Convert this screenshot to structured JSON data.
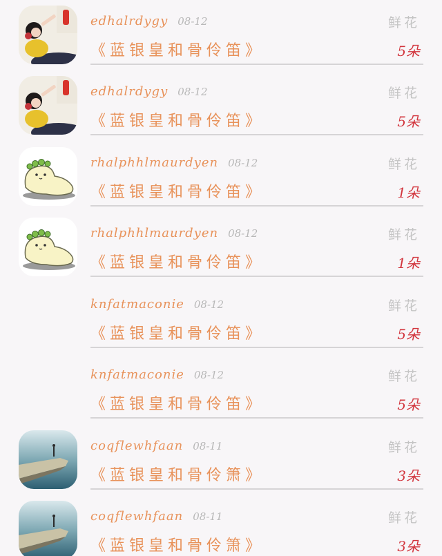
{
  "rows": [
    {
      "user": "edhalrdygy",
      "date": "08-12",
      "book": "《蓝银皇和骨伶笛》",
      "gift": "鲜花",
      "count": "5朵",
      "avatar": "girl-photo"
    },
    {
      "user": "edhalrdygy",
      "date": "08-12",
      "book": "《蓝银皇和骨伶笛》",
      "gift": "鲜花",
      "count": "5朵",
      "avatar": "girl-photo"
    },
    {
      "user": "rhalphhlmaurdyen",
      "date": "08-12",
      "book": "《蓝银皇和骨伶笛》",
      "gift": "鲜花",
      "count": "1朵",
      "avatar": "cartoon-blob"
    },
    {
      "user": "rhalphhlmaurdyen",
      "date": "08-12",
      "book": "《蓝银皇和骨伶笛》",
      "gift": "鲜花",
      "count": "1朵",
      "avatar": "cartoon-blob"
    },
    {
      "user": "knfatmaconie",
      "date": "08-12",
      "book": "《蓝银皇和骨伶笛》",
      "gift": "鲜花",
      "count": "5朵",
      "avatar": "none"
    },
    {
      "user": "knfatmaconie",
      "date": "08-12",
      "book": "《蓝银皇和骨伶笛》",
      "gift": "鲜花",
      "count": "5朵",
      "avatar": "none"
    },
    {
      "user": "coqflewhfaan",
      "date": "08-11",
      "book": "《蓝银皇和骨伶箫》",
      "gift": "鲜花",
      "count": "3朵",
      "avatar": "cliff-photo"
    },
    {
      "user": "coqflewhfaan",
      "date": "08-11",
      "book": "《蓝银皇和骨伶箫》",
      "gift": "鲜花",
      "count": "3朵",
      "avatar": "cliff-photo"
    }
  ],
  "colors": {
    "accent": "#e8925a",
    "count": "#d2353d",
    "muted": "#c4c4c4",
    "background": "#f8f6f8"
  }
}
